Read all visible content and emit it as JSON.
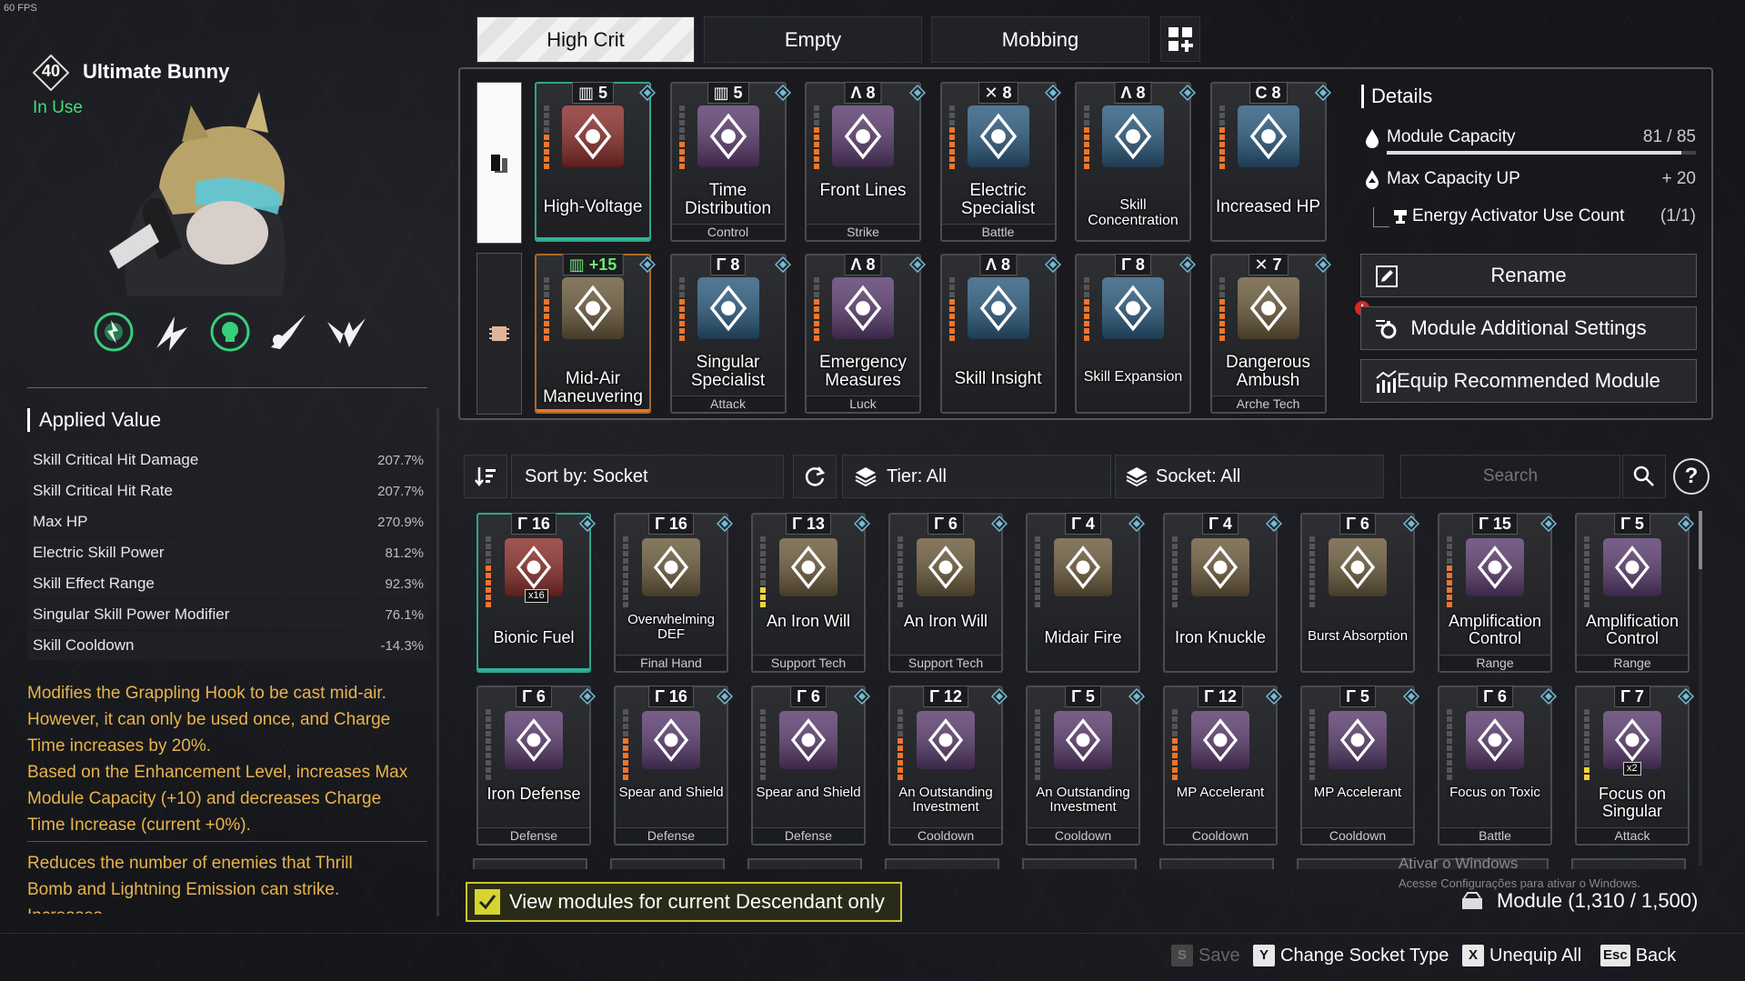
{
  "fps": "60 FPS",
  "character": {
    "level": "40",
    "name": "Ultimate Bunny",
    "status": "In Use",
    "skill_icons": [
      "lightning-target-icon",
      "lightning-dash-icon",
      "skull-target-icon",
      "blade-arm-icon",
      "thunder-wing-icon"
    ]
  },
  "applied_value": {
    "title": "Applied Value",
    "stats": [
      {
        "name": "Skill Critical Hit Damage",
        "value": "207.7%"
      },
      {
        "name": "Skill Critical Hit Rate",
        "value": "207.7%"
      },
      {
        "name": "Max HP",
        "value": "270.9%"
      },
      {
        "name": "Electric Skill Power",
        "value": "81.2%"
      },
      {
        "name": "Skill Effect Range",
        "value": "92.3%"
      },
      {
        "name": "Singular Skill Power Modifier",
        "value": "76.1%"
      },
      {
        "name": "Skill Cooldown",
        "value": "-14.3%"
      }
    ],
    "desc1": [
      "Modifies the Grappling Hook to be cast mid-air.",
      "However, it can only be used once, and Charge",
      "Time increases by 20%.",
      "Based on the Enhancement Level, increases Max",
      "Module Capacity (+10) and decreases Charge",
      "Time Increase (current +0%)."
    ],
    "desc2": [
      "Reduces the number of enemies that Thrill",
      "Bomb and Lightning Emission can strike.",
      "Increases ..."
    ]
  },
  "tabs": [
    {
      "label": "High Crit",
      "active": true
    },
    {
      "label": "Empty",
      "active": false
    },
    {
      "label": "Mobbing",
      "active": false
    }
  ],
  "equipped": [
    {
      "cost": "5",
      "sym": "▥",
      "name": "High-Voltage",
      "cat": "",
      "art": "#8a2d2a",
      "sel": "green",
      "bars": 5
    },
    {
      "cost": "5",
      "sym": "▥",
      "name": "Time Distribution",
      "cat": "Control",
      "art": "#5a3b6e",
      "bars": 4
    },
    {
      "cost": "8",
      "sym": "Λ",
      "name": "Front Lines",
      "cat": "Strike",
      "art": "#5a3b6e",
      "bars": 6
    },
    {
      "cost": "8",
      "sym": "✕",
      "name": "Electric Specialist",
      "cat": "Battle",
      "art": "#2b5a7e",
      "bars": 6
    },
    {
      "cost": "8",
      "sym": "Λ",
      "name": "Skill Concentration",
      "cat": "",
      "art": "#2b5a7e",
      "bars": 6,
      "small": true
    },
    {
      "cost": "8",
      "sym": "C",
      "name": "Increased HP",
      "cat": "",
      "art": "#2b5a7e",
      "bars": 6
    },
    {
      "cost": "+15",
      "sym": "▥",
      "name": "Mid-Air Maneuvering",
      "cat": "",
      "art": "#6b5a3b",
      "sel": "orange",
      "bars": 6,
      "green": true
    },
    {
      "cost": "8",
      "sym": "Γ",
      "name": "Singular Specialist",
      "cat": "Attack",
      "art": "#2b5a7e",
      "bars": 6
    },
    {
      "cost": "8",
      "sym": "Λ",
      "name": "Emergency Measures",
      "cat": "Luck",
      "art": "#5a3b6e",
      "bars": 6
    },
    {
      "cost": "8",
      "sym": "Λ",
      "name": "Skill Insight",
      "cat": "",
      "art": "#2b5a7e",
      "bars": 6
    },
    {
      "cost": "8",
      "sym": "Γ",
      "name": "Skill Expansion",
      "cat": "",
      "art": "#2b5a7e",
      "bars": 6,
      "small": true
    },
    {
      "cost": "7",
      "sym": "✕",
      "name": "Dangerous Ambush",
      "cat": "Arche Tech",
      "art": "#6b5a3b",
      "bars": 6
    }
  ],
  "details": {
    "title": "Details",
    "capacity_label": "Module Capacity",
    "capacity_value": "81 / 85",
    "capacity_fraction": 0.953,
    "max_cap_label": "Max Capacity UP",
    "max_cap_value": "+ 20",
    "energy_label": "Energy Activator Use Count",
    "energy_value": "(1/1)"
  },
  "buttons": {
    "rename": "Rename",
    "additional": "Module Additional Settings",
    "recommend": "Equip Recommended Module"
  },
  "filters": {
    "sort": "Sort by: Socket",
    "tier": "Tier: All",
    "socket": "Socket: All",
    "search_placeholder": "Search",
    "help": "?"
  },
  "inventory": [
    {
      "cost": "16",
      "name": "Bionic Fuel",
      "cat": "",
      "art": "#8a2d2a",
      "sel": "green",
      "bars": 6,
      "stack": "x16"
    },
    {
      "cost": "16",
      "name": "Overwhelming DEF",
      "cat": "Final Hand",
      "art": "#6b5a3b",
      "bars": 0,
      "small": true
    },
    {
      "cost": "13",
      "name": "An Iron Will",
      "cat": "Support Tech",
      "art": "#6b5a3b",
      "bars": 3,
      "yellow": true
    },
    {
      "cost": "6",
      "name": "An Iron Will",
      "cat": "Support Tech",
      "art": "#6b5a3b",
      "bars": 0
    },
    {
      "cost": "4",
      "name": "Midair Fire",
      "cat": "",
      "art": "#6b5a3b",
      "bars": 0
    },
    {
      "cost": "4",
      "name": "Iron Knuckle",
      "cat": "",
      "art": "#6b5a3b",
      "bars": 0
    },
    {
      "cost": "6",
      "name": "Burst Absorption",
      "cat": "",
      "art": "#6b5a3b",
      "bars": 0,
      "small": true
    },
    {
      "cost": "15",
      "name": "Amplification Control",
      "cat": "Range",
      "art": "#5a3b6e",
      "bars": 6
    },
    {
      "cost": "5",
      "name": "Amplification Control",
      "cat": "Range",
      "art": "#5a3b6e",
      "bars": 0
    },
    {
      "cost": "6",
      "name": "Iron Defense",
      "cat": "Defense",
      "art": "#5a3b6e",
      "bars": 0
    },
    {
      "cost": "16",
      "name": "Spear and Shield",
      "cat": "Defense",
      "art": "#5a3b6e",
      "bars": 6,
      "small": true
    },
    {
      "cost": "6",
      "name": "Spear and Shield",
      "cat": "Defense",
      "art": "#5a3b6e",
      "bars": 0,
      "small": true
    },
    {
      "cost": "12",
      "name": "An Outstanding Investment",
      "cat": "Cooldown",
      "art": "#5a3b6e",
      "bars": 6,
      "small": true
    },
    {
      "cost": "5",
      "name": "An Outstanding Investment",
      "cat": "Cooldown",
      "art": "#5a3b6e",
      "bars": 0,
      "small": true
    },
    {
      "cost": "12",
      "name": "MP Accelerant",
      "cat": "Cooldown",
      "art": "#5a3b6e",
      "bars": 6,
      "small": true
    },
    {
      "cost": "5",
      "name": "MP Accelerant",
      "cat": "Cooldown",
      "art": "#5a3b6e",
      "bars": 0,
      "small": true
    },
    {
      "cost": "6",
      "name": "Focus on Toxic",
      "cat": "Battle",
      "art": "#5a3b6e",
      "bars": 0,
      "small": true
    },
    {
      "cost": "7",
      "name": "Focus on Singular",
      "cat": "Attack",
      "art": "#5a3b6e",
      "bars": 2,
      "yellow": true,
      "stack": "x2"
    }
  ],
  "bottom": {
    "view_label": "View modules for current Descendant only",
    "watermark1": "Ativar o Windows",
    "watermark2": "Acesse Configurações para ativar o Windows.",
    "module_count": "Module (1,310 / 1,500)"
  },
  "hints": [
    {
      "key": "S",
      "label": "Save",
      "dim": true
    },
    {
      "key": "Y",
      "label": "Change Socket Type",
      "dim": false
    },
    {
      "key": "X",
      "label": "Unequip All",
      "dim": false
    },
    {
      "key": "Esc",
      "label": "Back",
      "dim": false
    }
  ]
}
